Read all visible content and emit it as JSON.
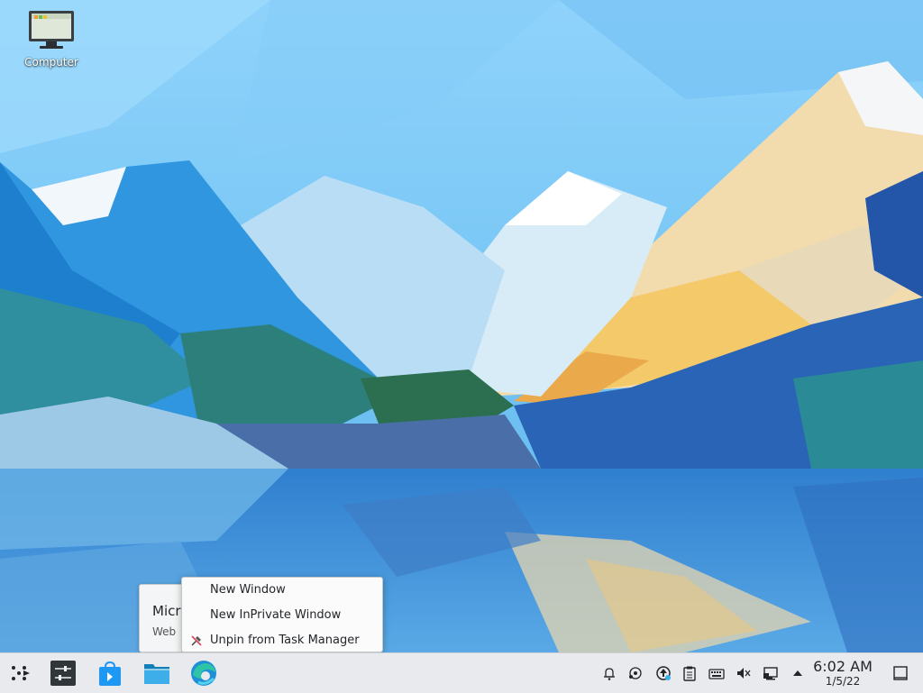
{
  "desktop": {
    "icons": [
      {
        "label": "Computer",
        "icon": "computer-monitor-icon"
      }
    ]
  },
  "tooltip": {
    "title": "Micr",
    "subtitle": "Web"
  },
  "context_menu": {
    "items": [
      {
        "label": "New Window",
        "icon": ""
      },
      {
        "label": "New InPrivate Window",
        "icon": ""
      },
      {
        "label": "Unpin from Task Manager",
        "icon": "unpin-icon"
      }
    ]
  },
  "taskbar": {
    "launcher_icon": "application-launcher-icon",
    "pinned": [
      {
        "name": "System Settings",
        "icon": "settings-sliders-icon"
      },
      {
        "name": "Discover",
        "icon": "store-bag-icon"
      },
      {
        "name": "Dolphin",
        "icon": "folder-icon"
      },
      {
        "name": "Microsoft Edge",
        "icon": "edge-browser-icon"
      }
    ],
    "tray": [
      "notifications-bell-icon",
      "kde-connect-icon",
      "updates-icon",
      "clipboard-icon",
      "keyboard-icon",
      "volume-muted-icon",
      "network-wired-icon",
      "expand-tray-arrow-icon"
    ],
    "clock": {
      "time": "6:02 AM",
      "date": "1/5/22"
    },
    "show_desktop_icon": "show-desktop-icon"
  },
  "colors": {
    "sky": "#7cc6f4",
    "taskbar": "#e8eaed",
    "accent": "#3daee9"
  }
}
